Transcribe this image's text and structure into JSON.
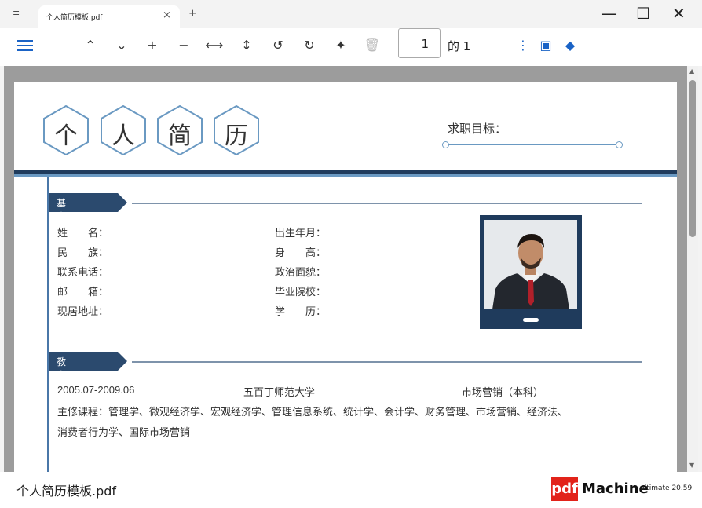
{
  "tab": {
    "menu_glyph": "≡",
    "title": "个人简历模板.pdf",
    "close_glyph": "×",
    "new_glyph": "+"
  },
  "window": {
    "minimize": "—",
    "maximize": "☐",
    "close": "✕"
  },
  "toolbar": {
    "prev_glyph": "⌃",
    "next_glyph": "⌄",
    "zoom_in_glyph": "+",
    "zoom_out_glyph": "−",
    "fit_width_glyph": "⟷",
    "fit_height_glyph": "↕",
    "rotate_ccw_glyph": "↺",
    "rotate_cw_glyph": "↻",
    "magic_glyph": "✦",
    "delete_glyph": "🗑",
    "page_value": "1",
    "of_label": "的 1",
    "more_glyph": "⋮",
    "image_glyph": "▣",
    "shapes_glyph": "◆"
  },
  "resume": {
    "title_chars": [
      "个",
      "人",
      "简",
      "历"
    ],
    "goal_label": "求职目标：",
    "sections": {
      "basic": "基本信息",
      "education": "教育背景"
    },
    "basic_left": [
      "姓　　名：",
      "民　　族：",
      "联系电话：",
      "邮　　箱：",
      "现居地址："
    ],
    "basic_right": [
      "出生年月：",
      "身　　高：",
      "政治面貌：",
      "毕业院校：",
      "学　　历："
    ],
    "edu_period": "2005.07-2009.06",
    "edu_school": "五百丁师范大学",
    "edu_major": "市场营销（本科）",
    "edu_courses_1": "主修课程：管理学、微观经济学、宏观经济学、管理信息系统、统计学、会计学、财务管理、市场营销、经济法、",
    "edu_courses_2": "消费者行为学、国际市场营销"
  },
  "status": {
    "filename": "个人简历模板.pdf",
    "brand_pdf": "pdf",
    "brand_machine": "Machine",
    "version": "ultimate 20.59"
  },
  "colors": {
    "accent": "#1a63c6",
    "resume_dark": "#1f3b5c",
    "resume_light": "#6a99c2",
    "brand_red": "#e2231a"
  }
}
